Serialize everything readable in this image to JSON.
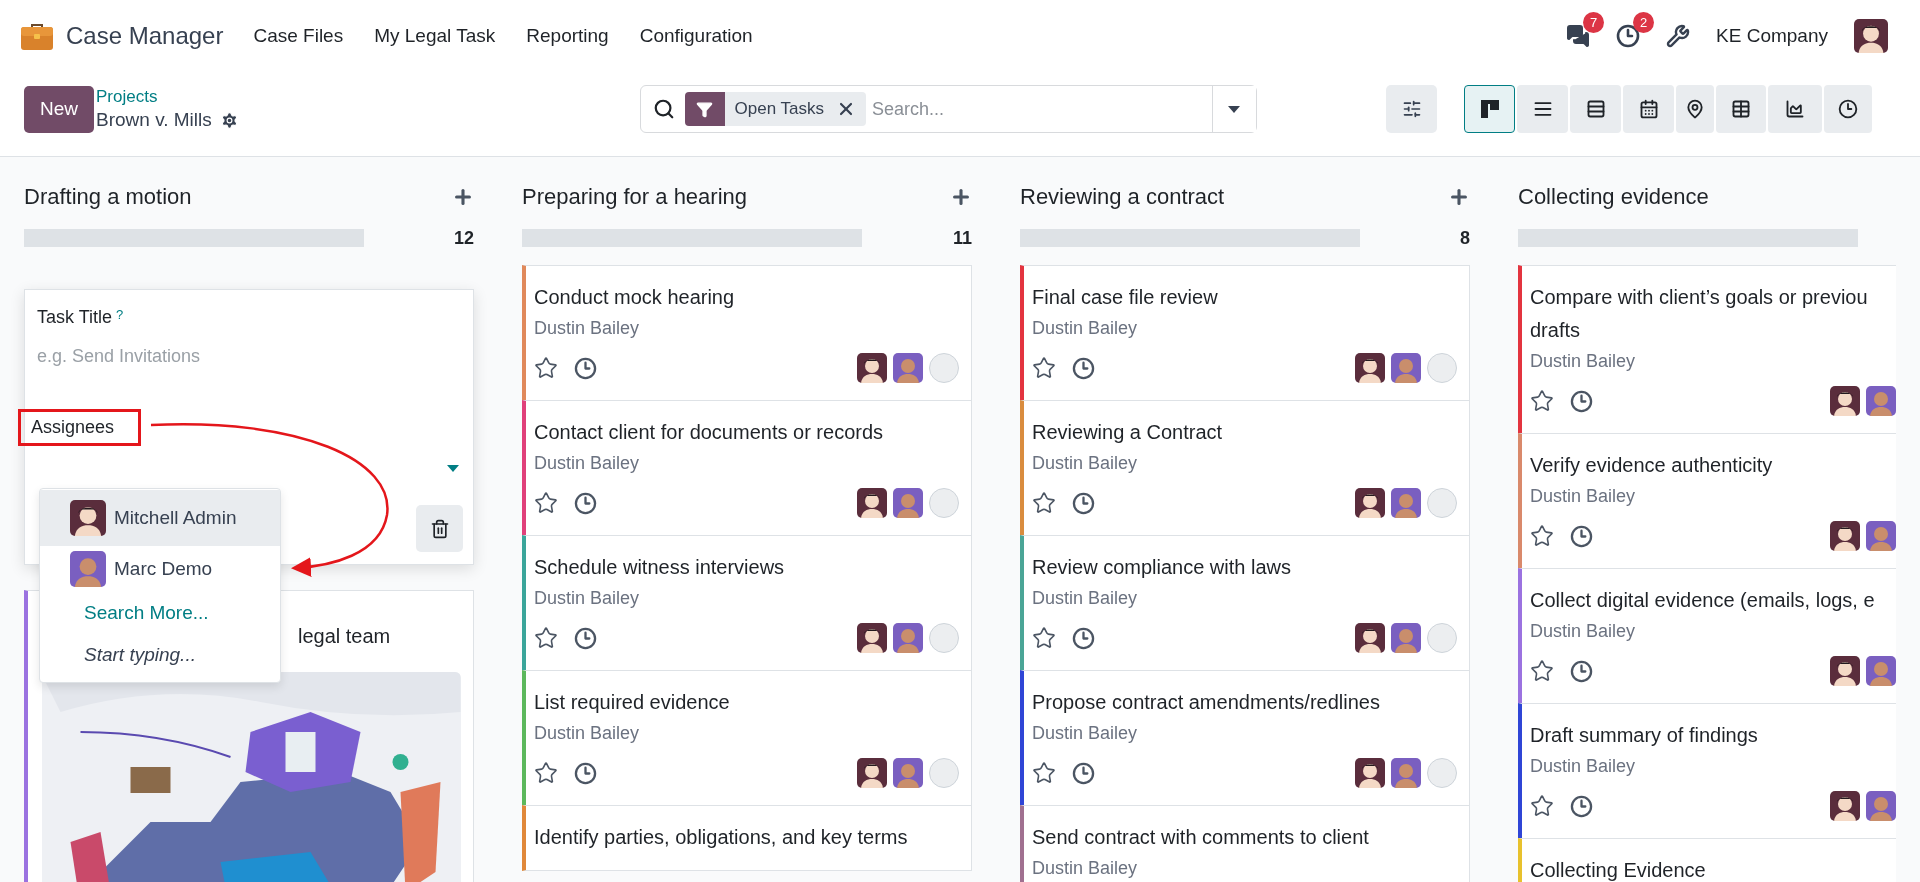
{
  "navbar": {
    "app_name": "Case Manager",
    "menu": [
      "Case Files",
      "My Legal Task",
      "Reporting",
      "Configuration"
    ],
    "messages_badge": "7",
    "activities_badge": "2",
    "company": "KE Company"
  },
  "control_panel": {
    "new_button": "New",
    "breadcrumb": "Projects",
    "project": "Brown v. Mills",
    "search": {
      "facet": "Open Tasks",
      "placeholder": "Search..."
    },
    "views": [
      {
        "kind": "kanban",
        "selected": true
      },
      {
        "kind": "list",
        "selected": false
      },
      {
        "kind": "gantt",
        "selected": false
      },
      {
        "kind": "calendar",
        "selected": false
      },
      {
        "kind": "map",
        "selected": false
      },
      {
        "kind": "pivot",
        "selected": false
      },
      {
        "kind": "graph",
        "selected": false
      },
      {
        "kind": "activity",
        "selected": false
      }
    ]
  },
  "columns": [
    {
      "title": "Drafting a motion",
      "count": "12",
      "add_button": true,
      "level": 0,
      "quick_create": {
        "title_label": "Task Title",
        "help_mark": "?",
        "title_placeholder": "e.g. Send Invitations",
        "assignees_label": "Assignees",
        "dropdown": [
          {
            "kind": "user",
            "avatar": {
              "kind": "admin"
            },
            "label": "Mitchell Admin",
            "selected": true
          },
          {
            "kind": "user",
            "avatar": {
              "kind": "demo"
            },
            "label": "Marc Demo",
            "selected": false
          },
          {
            "kind": "link",
            "label": "Search More..."
          },
          {
            "kind": "hint",
            "label": "Start typing..."
          }
        ]
      },
      "cards": [
        {
          "kind": "picture",
          "title": "legal team",
          "color": "#9b72e0"
        }
      ]
    },
    {
      "title": "Preparing for a hearing",
      "count": "11",
      "add_button": true,
      "level": 0,
      "cards": [
        {
          "kind": "task",
          "title": "Conduct mock hearing",
          "subtitle": "Dustin Bailey",
          "color": "#e0895b",
          "starred": false,
          "avatars": [
            {
              "kind": "admin"
            },
            {
              "kind": "demo"
            },
            {
              "kind": "empty"
            }
          ]
        },
        {
          "kind": "task",
          "title": "Contact client for documents or records",
          "subtitle": "Dustin Bailey",
          "color": "#e0407a",
          "starred": false,
          "avatars": [
            {
              "kind": "admin"
            },
            {
              "kind": "demo"
            },
            {
              "kind": "empty"
            }
          ]
        },
        {
          "kind": "task",
          "title": "Schedule witness interviews",
          "subtitle": "Dustin Bailey",
          "color": "#3aa59a",
          "starred": false,
          "avatars": [
            {
              "kind": "admin"
            },
            {
              "kind": "demo"
            },
            {
              "kind": "empty"
            }
          ]
        },
        {
          "kind": "task",
          "title": "List required evidence",
          "subtitle": "Dustin Bailey",
          "color": "#5cb85c",
          "starred": false,
          "avatars": [
            {
              "kind": "admin"
            },
            {
              "kind": "demo"
            },
            {
              "kind": "empty"
            }
          ]
        },
        {
          "kind": "task",
          "title": "Identify parties, obligations, and key terms",
          "color": "#e0883a"
        }
      ]
    },
    {
      "title": "Reviewing a contract",
      "count": "8",
      "add_button": true,
      "level": 0,
      "cards": [
        {
          "kind": "task",
          "title": "Final case file review",
          "subtitle": "Dustin Bailey",
          "color": "#e3343f",
          "starred": false,
          "avatars": [
            {
              "kind": "admin"
            },
            {
              "kind": "demo"
            },
            {
              "kind": "empty"
            }
          ]
        },
        {
          "kind": "task",
          "title": "Reviewing a Contract",
          "subtitle": "Dustin Bailey",
          "color": "#d98c3e",
          "starred": false,
          "avatars": [
            {
              "kind": "admin"
            },
            {
              "kind": "demo"
            },
            {
              "kind": "empty"
            }
          ]
        },
        {
          "kind": "task",
          "title": "Review compliance with laws",
          "subtitle": "Dustin Bailey",
          "color": "#4aa596",
          "starred": false,
          "avatars": [
            {
              "kind": "admin"
            },
            {
              "kind": "demo"
            },
            {
              "kind": "empty"
            }
          ]
        },
        {
          "kind": "task",
          "title": "Propose contract amendments/redlines",
          "subtitle": "Dustin Bailey",
          "color": "#2f45d6",
          "starred": false,
          "avatars": [
            {
              "kind": "admin"
            },
            {
              "kind": "demo"
            },
            {
              "kind": "empty"
            }
          ]
        },
        {
          "kind": "task",
          "title": "Send contract with comments to client",
          "subtitle": "Dustin Bailey",
          "color": "#a07090"
        }
      ]
    },
    {
      "title": "Collecting evidence",
      "add_button": false,
      "level": 0,
      "cards": [
        {
          "kind": "task",
          "title": "Compare with client’s goals or previou",
          "title_line_2": "drafts",
          "subtitle": "Dustin Bailey",
          "color": "#e3343f",
          "starred": false,
          "avatars": [
            {
              "kind": "admin"
            },
            {
              "kind": "demo"
            }
          ]
        },
        {
          "kind": "task",
          "title": "Verify evidence authenticity",
          "subtitle": "Dustin Bailey",
          "color": "#d9896b",
          "starred": false,
          "avatars": [
            {
              "kind": "admin"
            },
            {
              "kind": "demo"
            }
          ]
        },
        {
          "kind": "task",
          "title": "Collect digital evidence (emails, logs, e",
          "subtitle": "Dustin Bailey",
          "color": "#9b72e0",
          "starred": false,
          "avatars": [
            {
              "kind": "admin"
            },
            {
              "kind": "demo"
            }
          ]
        },
        {
          "kind": "task",
          "title": "Draft summary of findings",
          "subtitle": "Dustin Bailey",
          "color": "#2f45d6",
          "starred": false,
          "avatars": [
            {
              "kind": "admin"
            },
            {
              "kind": "demo"
            }
          ]
        },
        {
          "kind": "task",
          "title": "Collecting Evidence",
          "color": "#e8c12d"
        }
      ]
    }
  ]
}
